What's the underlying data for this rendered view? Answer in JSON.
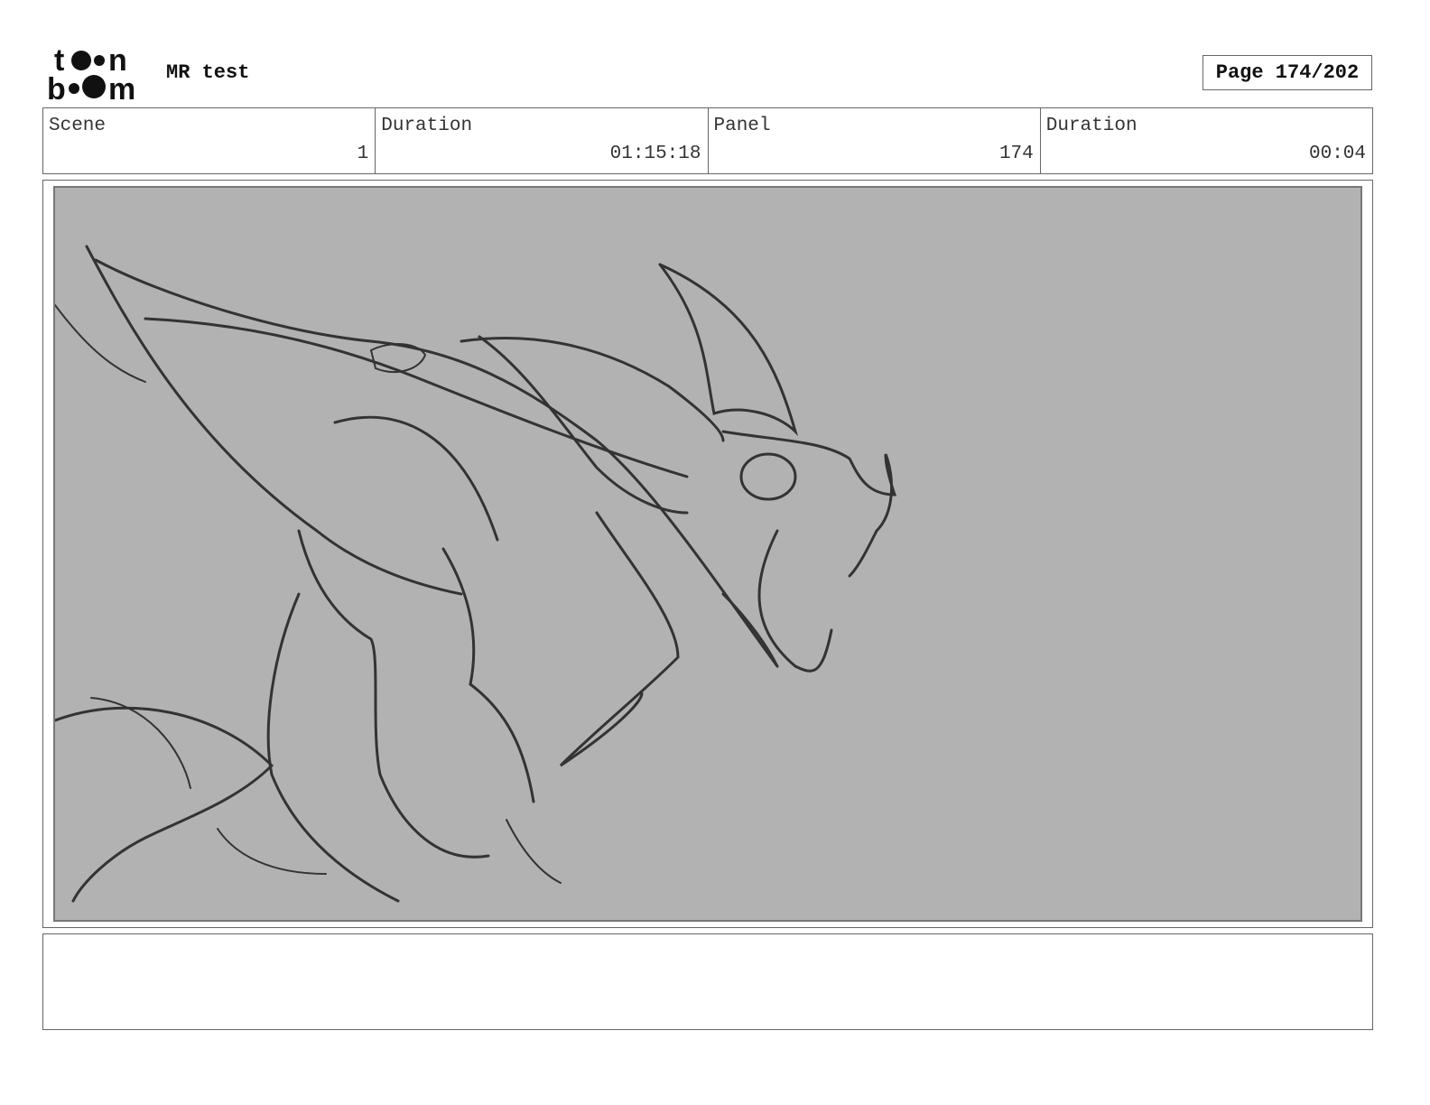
{
  "header": {
    "logo_text": "toon boom",
    "project_title": "MR test",
    "page_label": "Page 174/202"
  },
  "info": [
    {
      "label": "Scene",
      "value": "1"
    },
    {
      "label": "Duration",
      "value": "01:15:18"
    },
    {
      "label": "Panel",
      "value": "174"
    },
    {
      "label": "Duration",
      "value": "00:04"
    }
  ],
  "panel": {
    "background": "#b2b2b2"
  },
  "notes": {
    "text": ""
  }
}
